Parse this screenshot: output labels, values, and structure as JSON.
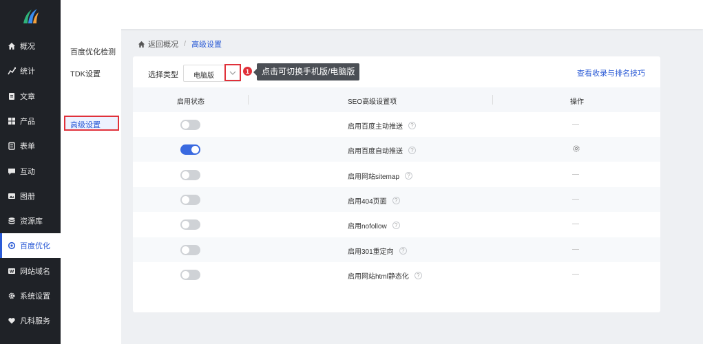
{
  "nav": {
    "items": [
      {
        "label": "概况",
        "icon": "home-icon"
      },
      {
        "label": "统计",
        "icon": "stats-icon"
      },
      {
        "label": "文章",
        "icon": "article-icon"
      },
      {
        "label": "产品",
        "icon": "grid-icon"
      },
      {
        "label": "表单",
        "icon": "form-icon"
      },
      {
        "label": "互动",
        "icon": "chat-icon"
      },
      {
        "label": "图册",
        "icon": "image-icon"
      },
      {
        "label": "资源库",
        "icon": "database-icon"
      },
      {
        "label": "百度优化",
        "icon": "refresh-icon"
      },
      {
        "label": "网站域名",
        "icon": "web-icon"
      },
      {
        "label": "系统设置",
        "icon": "gear-icon"
      },
      {
        "label": "凡科服务",
        "icon": "heart-icon"
      }
    ],
    "active_index": 8
  },
  "submenu": {
    "items": [
      "百度优化检测",
      "TDK设置",
      "高级设置"
    ],
    "active_index": 2
  },
  "breadcrumb": {
    "back": "返回概况",
    "separator": "/",
    "current": "高级设置"
  },
  "toolbar": {
    "select_label": "选择类型",
    "select_value": "电脑版",
    "badge": "1",
    "tooltip": "点击可切换手机版/电脑版",
    "help_link": "查看收录与排名技巧"
  },
  "table": {
    "headers": [
      "启用状态",
      "SEO高级设置项",
      "操作"
    ],
    "rows": [
      {
        "label": "启用百度主动推送",
        "enabled": false,
        "action": "none"
      },
      {
        "label": "启用百度自动推送",
        "enabled": true,
        "action": "settings"
      },
      {
        "label": "启用网站sitemap",
        "enabled": false,
        "action": "none"
      },
      {
        "label": "启用404页面",
        "enabled": false,
        "action": "none"
      },
      {
        "label": "启用nofollow",
        "enabled": false,
        "action": "none"
      },
      {
        "label": "启用301重定向",
        "enabled": false,
        "action": "none"
      },
      {
        "label": "启用网站html静态化",
        "enabled": false,
        "action": "none"
      }
    ],
    "help_glyph": "?"
  },
  "colors": {
    "sidebar_bg": "#1f2227",
    "accent": "#2b5bd6",
    "highlight_red": "#e0313a",
    "toggle_on": "#3a6ae0",
    "toggle_off": "#cfd2d6"
  }
}
